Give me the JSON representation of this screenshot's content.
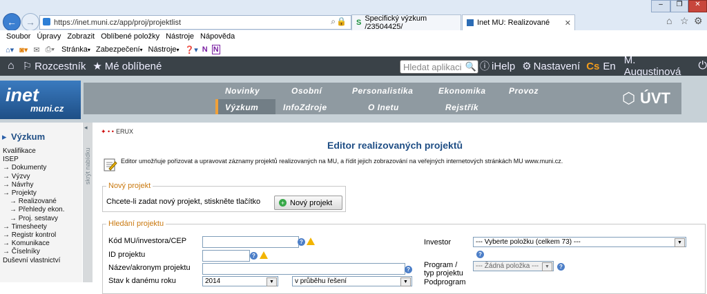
{
  "browser": {
    "url": "https://inet.muni.cz/app/proj/projektlist",
    "tabs": [
      {
        "label": "Specifický výzkum /23504425/"
      },
      {
        "label": "Inet MU: Realizované"
      }
    ],
    "menu": [
      "Soubor",
      "Úpravy",
      "Zobrazit",
      "Oblíbené položky",
      "Nástroje",
      "Nápověda"
    ],
    "commands": {
      "page": "Stránka",
      "security": "Zabezpečení",
      "tools": "Nástroje"
    }
  },
  "inet_bar": {
    "rozcestnik": "Rozcestník",
    "oblibene": "Mé oblíbené",
    "search_placeholder": "Hledat aplikaci",
    "ihelp": "iHelp",
    "settings": "Nastavení",
    "lang_cs": "Cs",
    "lang_en": "En",
    "user": "M. Augustinová"
  },
  "header": {
    "logo_line1": "inet",
    "logo_line2": "muni.cz",
    "nav_row1": [
      "Novinky",
      "Osobní",
      "Personalistika",
      "Ekonomika",
      "Provoz"
    ],
    "nav_row2": [
      "Výzkum",
      "InfoZdroje",
      "O Inetu",
      "Rejstřík"
    ],
    "uvt": "ÚVT"
  },
  "sidebar": {
    "title": "Výzkum",
    "collapse": "skrýt nabídku",
    "items": [
      "Kvalifikace",
      "ISEP",
      "→ Dokumenty",
      "→ Výzvy",
      "→ Návrhy",
      "→ Projekty",
      "→ Realizované",
      "→ Přehledy ekon.",
      "→ Proj. sestavy",
      "→ Timesheety",
      "→ Registr kontrol",
      "→ Komunikace",
      "→ Číselníky",
      "Duševní vlastnictví"
    ]
  },
  "content": {
    "breadcrumb": "ERUX",
    "title": "Editor realizovaných projektů",
    "description": "Editor umožňuje pořizovat a upravovat záznamy projektů realizovaných na MU, a řídit jejich zobrazování na veřejných internetových stránkách MU www.muni.cz.",
    "new_project": {
      "legend": "Nový projekt",
      "text": "Chcete-li zadat nový projekt, stiskněte tlačítko",
      "button": "Nový projekt"
    },
    "search": {
      "legend": "Hledání projektu",
      "kod_label": "Kód MU/investora/CEP",
      "id_label": "ID projektu",
      "nazev_label": "Název/akronym projektu",
      "stav_label": "Stav k danému roku",
      "stav_year": "2014",
      "stav_value": "v průběhu řešení",
      "investor_label": "Investor",
      "investor_value": "--- Vyberte položku (celkem 73) ---",
      "program_label_1": "Program /",
      "program_label_2": "typ projektu",
      "program_value": "--- Žádná položka ---",
      "podprogram_label": "Podprogram"
    }
  }
}
